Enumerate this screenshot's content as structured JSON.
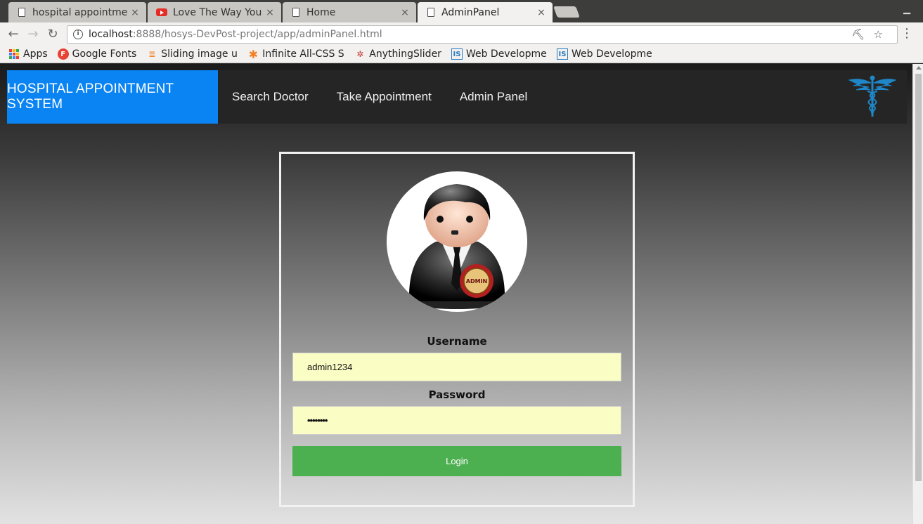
{
  "browser": {
    "tabs": [
      {
        "title": "hospital appointmen",
        "icon": "page-icon",
        "active": false
      },
      {
        "title": "Love The Way You Li",
        "icon": "youtube-icon",
        "active": false
      },
      {
        "title": "Home",
        "icon": "page-icon",
        "active": false
      },
      {
        "title": "AdminPanel",
        "icon": "page-icon",
        "active": true
      }
    ],
    "close_glyph": "×",
    "address": {
      "host": "localhost",
      "path": ":8888/hosys-DevPost-project/app/adminPanel.html"
    },
    "bookmarks": [
      {
        "label": "Apps",
        "icon": "apps-grid-icon"
      },
      {
        "label": "Google Fonts",
        "icon": "google-fonts-icon"
      },
      {
        "label": "Sliding image usin",
        "icon": "stackoverflow-icon"
      },
      {
        "label": "Infinite All-CSS Scr",
        "icon": "asterisk-icon"
      },
      {
        "label": "AnythingSlider",
        "icon": "anythingslider-icon"
      },
      {
        "label": "Web Development",
        "icon": "is-icon"
      },
      {
        "label": "Web Development",
        "icon": "is-icon"
      }
    ]
  },
  "navbar": {
    "brand": "HOSPITAL APPOINTMENT SYSTEM",
    "links": [
      "Search Doctor",
      "Take Appointment",
      "Admin Panel"
    ],
    "logo_icon": "caduceus-icon"
  },
  "login": {
    "avatar_icon": "admin-avatar-icon",
    "badge_text": "ADMIN",
    "username_label": "Username",
    "username_value": "admin1234",
    "password_label": "Password",
    "password_value": "••••••••",
    "button_label": "Login"
  },
  "colors": {
    "brand": "#0b84f3",
    "button": "#4caf50",
    "input_bg": "#fafdc4"
  }
}
